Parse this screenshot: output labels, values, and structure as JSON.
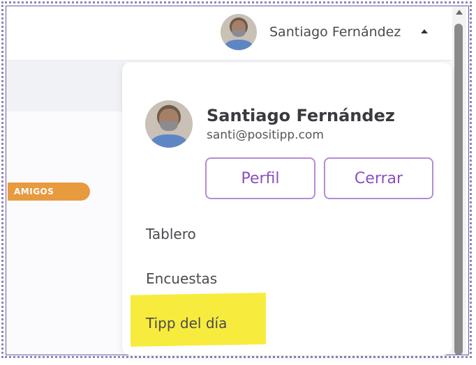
{
  "header": {
    "user_name": "Santiago Fernández",
    "caret": "caret-up-icon"
  },
  "page": {
    "badge_label": "AMIGOS",
    "badge_color": "#e89a3f"
  },
  "dropdown": {
    "name": "Santiago Fernández",
    "email": "santi@positipp.com",
    "buttons": {
      "profile_label": "Perfil",
      "logout_label": "Cerrar"
    },
    "items": [
      {
        "label": "Tablero"
      },
      {
        "label": "Encuestas"
      },
      {
        "label": "Tipp del día",
        "highlighted": true
      }
    ],
    "accent_color": "#8a4fc0",
    "highlight_color": "#f7ec3d"
  }
}
